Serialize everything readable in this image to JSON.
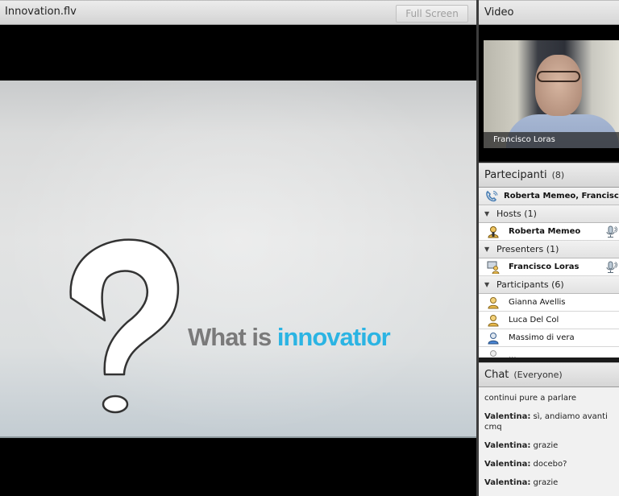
{
  "share_pod": {
    "title": "Innovation.flv",
    "fullscreen_label": "Full Screen",
    "slide": {
      "symbol": "?",
      "text_prefix": "What is",
      "text_highlight": "innovatior"
    }
  },
  "video_pod": {
    "title": "Video",
    "caption": "Francisco Loras"
  },
  "attendees_pod": {
    "title": "Partecipanti",
    "count": "(8)",
    "phone_row": "Roberta Memeo, Francisco L...",
    "groups": [
      {
        "label": "Hosts (1)",
        "users": [
          {
            "name": "Roberta Memeo",
            "role": "host",
            "mic": true
          }
        ]
      },
      {
        "label": "Presenters (1)",
        "users": [
          {
            "name": "Francisco Loras",
            "role": "presenter",
            "mic": true
          }
        ]
      },
      {
        "label": "Participants (6)",
        "users": [
          {
            "name": "Gianna Avellis",
            "role": "participant"
          },
          {
            "name": "Luca Del Col",
            "role": "participant"
          },
          {
            "name": "Massimo di vera",
            "role": "participant-guest"
          },
          {
            "name": "...",
            "role": "participant"
          }
        ]
      }
    ]
  },
  "chat_pod": {
    "title": "Chat",
    "scope": "(Everyone)",
    "messages": [
      {
        "sender": "",
        "text": "continui pure a parlare"
      },
      {
        "sender": "Valentina:",
        "text": "sì, andiamo avanti cmq"
      },
      {
        "sender": "Valentina:",
        "text": "grazie"
      },
      {
        "sender": "Valentina:",
        "text": "docebo?"
      },
      {
        "sender": "Valentina:",
        "text": "grazie"
      }
    ]
  },
  "colors": {
    "slide_highlight": "#2bb4e3",
    "slide_text": "#7a7a7a",
    "host_icon": "#e8b84a",
    "guest_icon": "#4a86d4"
  }
}
